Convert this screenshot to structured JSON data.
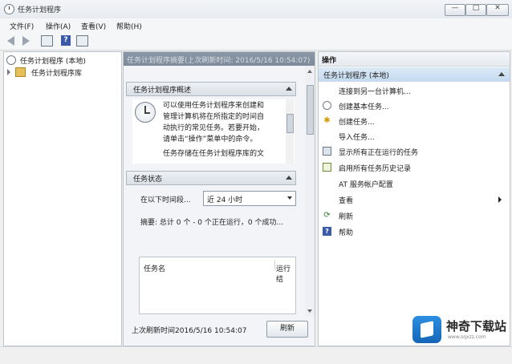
{
  "window": {
    "title": "任务计划程序"
  },
  "window_buttons": {
    "minimize": "—",
    "maximize": "□",
    "close": "✕"
  },
  "menu": [
    "文件(F)",
    "操作(A)",
    "查看(V)",
    "帮助(H)"
  ],
  "toolbar": {
    "icons": [
      "back-arrow-icon",
      "forward-arrow-icon",
      "show-hide-console-tree-icon",
      "help-icon",
      "properties-icon"
    ]
  },
  "tree": {
    "root": "任务计划程序 (本地)",
    "child": "任务计划程序库"
  },
  "middle": {
    "header": "任务计划程序摘要(上次刷新时间: 2016/5/16 10:54:07)",
    "overview": {
      "title": "任务计划程序概述",
      "lines": [
        "可以使用任务计划程序来创建和",
        "管理计算机将在所指定的时间自",
        "动执行的常见任务。若要开始，",
        "请单击“操作”菜单中的命令。",
        "任务存储在任务计划程序库的文"
      ]
    },
    "status": {
      "title": "任务状态",
      "filter_label": "在以下时间段...",
      "filter_value": "近 24 小时",
      "summary": "摘要: 总计 0 个 - 0 个正在运行，0 个成功..."
    },
    "task_table": {
      "columns": [
        "任务名",
        "运行结"
      ]
    },
    "footer": {
      "last_refresh": "上次刷新时间2016/5/16 10:54:07",
      "refresh_button": "刷新"
    }
  },
  "actions": {
    "title": "操作",
    "group": "任务计划程序 (本地)",
    "items": [
      {
        "label": "连接到另一台计算机...",
        "icon": "none"
      },
      {
        "label": "创建基本任务...",
        "icon": "clock-icon"
      },
      {
        "label": "创建任务...",
        "icon": "star-icon"
      },
      {
        "label": "导入任务...",
        "icon": "none"
      },
      {
        "label": "显示所有正在运行的任务",
        "icon": "list-icon"
      },
      {
        "label": "启用所有任务历史记录",
        "icon": "history-icon"
      },
      {
        "label": "AT 服务帐户配置",
        "icon": "none"
      },
      {
        "label": "查看",
        "icon": "none"
      },
      {
        "label": "刷新",
        "icon": "refresh-icon"
      },
      {
        "label": "帮助",
        "icon": "help-icon"
      }
    ]
  },
  "watermark": {
    "name": "神奇下载站",
    "url": "www.sqxzz.com"
  }
}
